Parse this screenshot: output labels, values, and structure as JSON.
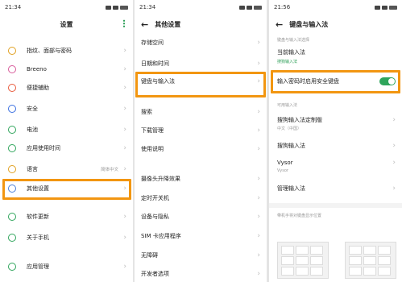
{
  "panel1": {
    "time": "21:34",
    "title": "设置",
    "items": [
      {
        "label": "指纹、面部与密码",
        "icon": "lock-icon",
        "color": "#e0a020"
      },
      {
        "label": "Breeno",
        "icon": "breeno-icon",
        "color": "#d85a9a"
      },
      {
        "label": "便捷辅助",
        "icon": "assist-icon",
        "color": "#e85a3c"
      },
      {
        "label": "安全",
        "icon": "shield-icon",
        "color": "#3a6fe0"
      },
      {
        "label": "电池",
        "icon": "battery-icon",
        "color": "#2fa55b"
      },
      {
        "label": "应用使用时间",
        "icon": "hourglass-icon",
        "color": "#2fa55b"
      },
      {
        "label": "语言",
        "icon": "language-icon",
        "color": "#e0a020",
        "value": "简体中文"
      },
      {
        "label": "其他设置",
        "icon": "more-settings-icon",
        "color": "#4a7fd8"
      },
      {
        "label": "软件更新",
        "icon": "update-icon",
        "color": "#2fa55b"
      },
      {
        "label": "关于手机",
        "icon": "info-icon",
        "color": "#2fa55b"
      },
      {
        "label": "应用管理",
        "icon": "apps-icon",
        "color": "#2fa55b"
      }
    ]
  },
  "panel2": {
    "time": "21:34",
    "title": "其他设置",
    "items": [
      {
        "label": "存储空间"
      },
      {
        "label": "日期和时间"
      },
      {
        "label": "键盘与输入法"
      },
      {
        "label": "搜索"
      },
      {
        "label": "下载管理"
      },
      {
        "label": "使用说明"
      },
      {
        "label": "摄像头升降效果"
      },
      {
        "label": "定时开关机"
      },
      {
        "label": "设备与隐私"
      },
      {
        "label": "SIM 卡应用程序"
      },
      {
        "label": "无障碍"
      },
      {
        "label": "开发者选项"
      }
    ]
  },
  "panel3": {
    "time": "21:56",
    "title": "键盘与输入法",
    "section_ime": "键盘与输入法选择",
    "current_ime_label": "当前输入法",
    "current_ime_value": "搜狗输入法",
    "secure_keyboard_label": "输入密码时启用安全键盘",
    "secure_keyboard_on": true,
    "section_available": "可用输入法",
    "ime1_label": "搜狗输入法定制版",
    "ime1_sub": "中文（中国）",
    "ime2_label": "搜狗输入法",
    "ime3_label": "Vysor",
    "ime3_sub": "Vysor",
    "manage_label": "管理输入法",
    "section_keyboard": "带机手将对键盘显示位置"
  },
  "colors": {
    "accent": "#2fa55b",
    "highlight": "#f29611"
  }
}
